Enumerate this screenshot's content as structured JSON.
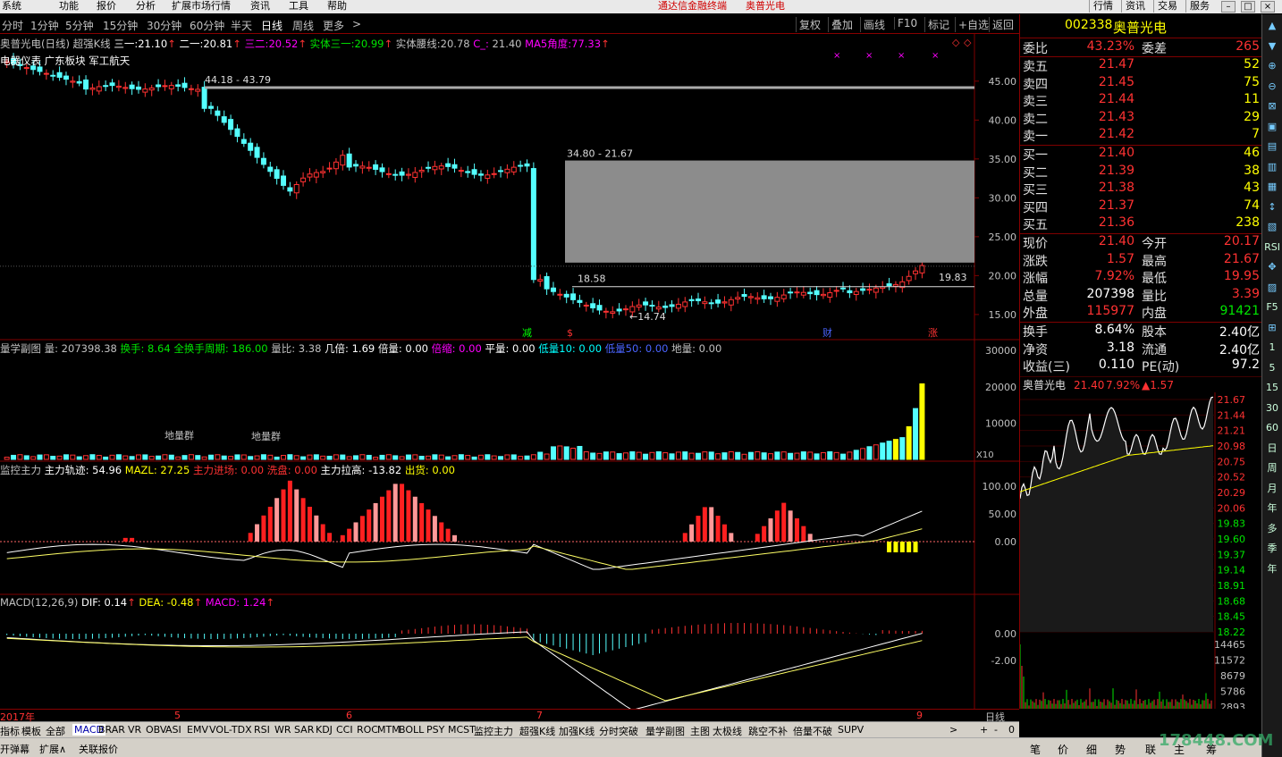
{
  "menu": {
    "items": [
      "系统",
      "功能",
      "报价",
      "分析",
      "扩展市场行情",
      "资讯",
      "工具",
      "帮助"
    ],
    "center_title": "通达信金融终端",
    "center_stock": "奥普光电",
    "right_buttons": [
      "行情",
      "资讯",
      "交易",
      "服务"
    ],
    "window_buttons": [
      "–",
      "□",
      "×"
    ]
  },
  "periods": {
    "items": [
      "分时",
      "1分钟",
      "5分钟",
      "15分钟",
      "30分钟",
      "60分钟",
      "半天",
      "日线",
      "周线",
      "更多"
    ],
    "more_arrow": ">",
    "active_index": 7,
    "tools": [
      "复权",
      "叠加",
      "画线",
      "F10",
      "标记",
      "+自选",
      "返回"
    ]
  },
  "main_chart": {
    "header": {
      "name": "奥普光电(日线)",
      "indicator": "超强K线",
      "san_yi_label": "三一:",
      "san_yi": "21.10",
      "er_yi_label": "二一:",
      "er_yi": "20.81",
      "san_er_label": "三二:",
      "san_er": "20.52",
      "shiti_label": "实体三一:",
      "shiti": "20.99",
      "yaoxian_label": "实体腰线:",
      "yaoxian": "20.78",
      "c_label": "C_:",
      "c": "21.40",
      "ma5_label": "MA5角度:",
      "ma5": "77.33"
    },
    "sector_label": "电器仪表 广东板块 军工航天",
    "annotations": {
      "gap1": "44.18 - 43.79",
      "gap2": "34.80 - 21.67",
      "low1": "18.58",
      "low2": "←14.74",
      "last_low": "19.83"
    },
    "markers": [
      "减",
      "$",
      "财",
      "涨"
    ],
    "y_axis": [
      "45.00",
      "40.00",
      "35.00",
      "30.00",
      "25.00",
      "20.00",
      "15.00"
    ],
    "y_min": 12,
    "y_max": 49
  },
  "vol_panel": {
    "title": "量学副图",
    "fields": [
      {
        "label": "量:",
        "value": "207398.38",
        "color": "gry"
      },
      {
        "label": "换手:",
        "value": "8.64",
        "color": "grn"
      },
      {
        "label": "全换手周期:",
        "value": "186.00",
        "color": "grn"
      },
      {
        "label": "量比:",
        "value": "3.38",
        "color": "gry"
      },
      {
        "label": "几倍:",
        "value": "1.69",
        "color": "wht"
      },
      {
        "label": "倍量:",
        "value": "0.00",
        "color": "wht"
      },
      {
        "label": "倍缩:",
        "value": "0.00",
        "color": "mag"
      },
      {
        "label": "平量:",
        "value": "0.00",
        "color": "wht"
      },
      {
        "label": "低量10:",
        "value": "0.00",
        "color": "cyn"
      },
      {
        "label": "低量50:",
        "value": "0.00",
        "color": "blu"
      },
      {
        "label": "地量:",
        "value": "0.00",
        "color": "gry"
      }
    ],
    "groups": [
      "地量群",
      "地量群"
    ],
    "scale_tag": "X10",
    "y_axis": [
      "30000",
      "20000",
      "10000"
    ]
  },
  "monitor_panel": {
    "title": "监控主力",
    "fields": [
      {
        "label": "主力轨迹:",
        "value": "54.96",
        "color": "wht"
      },
      {
        "label": "MAZL:",
        "value": "27.25",
        "color": "yel"
      },
      {
        "label": "主力进场:",
        "value": "0.00",
        "color": "red"
      },
      {
        "label": "洗盘:",
        "value": "0.00",
        "color": "red"
      },
      {
        "label": "主力拉高:",
        "value": "-13.82",
        "color": "wht"
      },
      {
        "label": "出货:",
        "value": "0.00",
        "color": "yel"
      }
    ],
    "y_axis": [
      "100.00",
      "50.00",
      "0.00"
    ]
  },
  "macd_panel": {
    "title": "MACD(12,26,9)",
    "dif_label": "DIF:",
    "dif": "0.14",
    "dea_label": "DEA:",
    "dea": "-0.48",
    "macd_label": "MACD:",
    "macd": "1.24",
    "y_axis": [
      "0.00",
      "-2.00"
    ]
  },
  "date_axis": {
    "labels": [
      "2017年",
      "5",
      "6",
      "7",
      "9"
    ],
    "period": "日线"
  },
  "bottom_tabs": [
    "指标",
    "模板",
    "全部",
    "MACD",
    "BRAR",
    "VR",
    "OBV",
    "ASI",
    "EMV",
    "VOL-TDX",
    "RSI",
    "WR",
    "SAR",
    "KDJ",
    "CCI",
    "ROC",
    "MTM",
    "BOLL",
    "PSY",
    "MCST",
    "监控主力",
    "超强K线",
    "加强K线",
    "分时突破",
    "量学副图",
    "主图",
    "太极线",
    "跳空不补",
    "倍量不破",
    "SUPV"
  ],
  "bottom_tabs_active": 3,
  "bottom_nav": [
    ">",
    "+",
    "-",
    "0"
  ],
  "status": {
    "items": [
      "开弹幕",
      "扩展∧",
      "关联报价"
    ],
    "right_tabs": [
      "笔",
      "价",
      "细",
      "势",
      "联",
      "主",
      "筹"
    ],
    "watermark": "178448.COM"
  },
  "quote": {
    "code": "002338",
    "name": "奥普光电",
    "weibi_label": "委比",
    "weibi": "43.23%",
    "weicha_label": "委差",
    "weicha": "265",
    "asks": [
      {
        "label": "卖五",
        "price": "21.47",
        "vol": "52"
      },
      {
        "label": "卖四",
        "price": "21.45",
        "vol": "75"
      },
      {
        "label": "卖三",
        "price": "21.44",
        "vol": "11"
      },
      {
        "label": "卖二",
        "price": "21.43",
        "vol": "29"
      },
      {
        "label": "卖一",
        "price": "21.42",
        "vol": "7"
      }
    ],
    "bids": [
      {
        "label": "买一",
        "price": "21.40",
        "vol": "46"
      },
      {
        "label": "买二",
        "price": "21.39",
        "vol": "38"
      },
      {
        "label": "买三",
        "price": "21.38",
        "vol": "43"
      },
      {
        "label": "买四",
        "price": "21.37",
        "vol": "74"
      },
      {
        "label": "买五",
        "price": "21.36",
        "vol": "238"
      }
    ],
    "stats": [
      {
        "l1": "现价",
        "v1": "21.40",
        "c1": "red",
        "l2": "今开",
        "v2": "20.17",
        "c2": "red"
      },
      {
        "l1": "涨跌",
        "v1": "1.57",
        "c1": "red",
        "l2": "最高",
        "v2": "21.67",
        "c2": "red"
      },
      {
        "l1": "涨幅",
        "v1": "7.92%",
        "c1": "red",
        "l2": "最低",
        "v2": "19.95",
        "c2": "red"
      },
      {
        "l1": "总量",
        "v1": "207398",
        "c1": "wht",
        "l2": "量比",
        "v2": "3.39",
        "c2": "red"
      },
      {
        "l1": "外盘",
        "v1": "115977",
        "c1": "red",
        "l2": "内盘",
        "v2": "91421",
        "c2": "grn"
      }
    ],
    "stats2": [
      {
        "l1": "换手",
        "v1": "8.64%",
        "l2": "股本",
        "v2": "2.40亿"
      },
      {
        "l1": "净资",
        "v1": "3.18",
        "l2": "流通",
        "v2": "2.40亿"
      },
      {
        "l1": "收益(三)",
        "v1": "0.110",
        "l2": "PE(动)",
        "v2": "97.2"
      }
    ]
  },
  "mini_chart": {
    "name": "奥普光电",
    "price": "21.40",
    "pct": "7.92%",
    "chg": "▲1.57",
    "price_axis": [
      "21.67",
      "21.44",
      "21.21",
      "20.98",
      "20.75",
      "20.52",
      "20.29",
      "20.06",
      "19.83",
      "19.60",
      "19.37",
      "19.14",
      "18.91",
      "18.68",
      "18.45",
      "18.22"
    ],
    "vol_axis": [
      "14465",
      "11572",
      "8679",
      "5786",
      "2893"
    ]
  },
  "side_tools": [
    "▲",
    "▼",
    "⊕",
    "⊖",
    "⊠",
    "▣",
    "▤",
    "▥",
    "▦",
    "↕",
    "▧",
    "RSI",
    "✥",
    "▨",
    "F5",
    "⊞",
    "1",
    "5",
    "15",
    "30",
    "60",
    "日",
    "周",
    "月",
    "年",
    "多",
    "季",
    "年"
  ]
}
